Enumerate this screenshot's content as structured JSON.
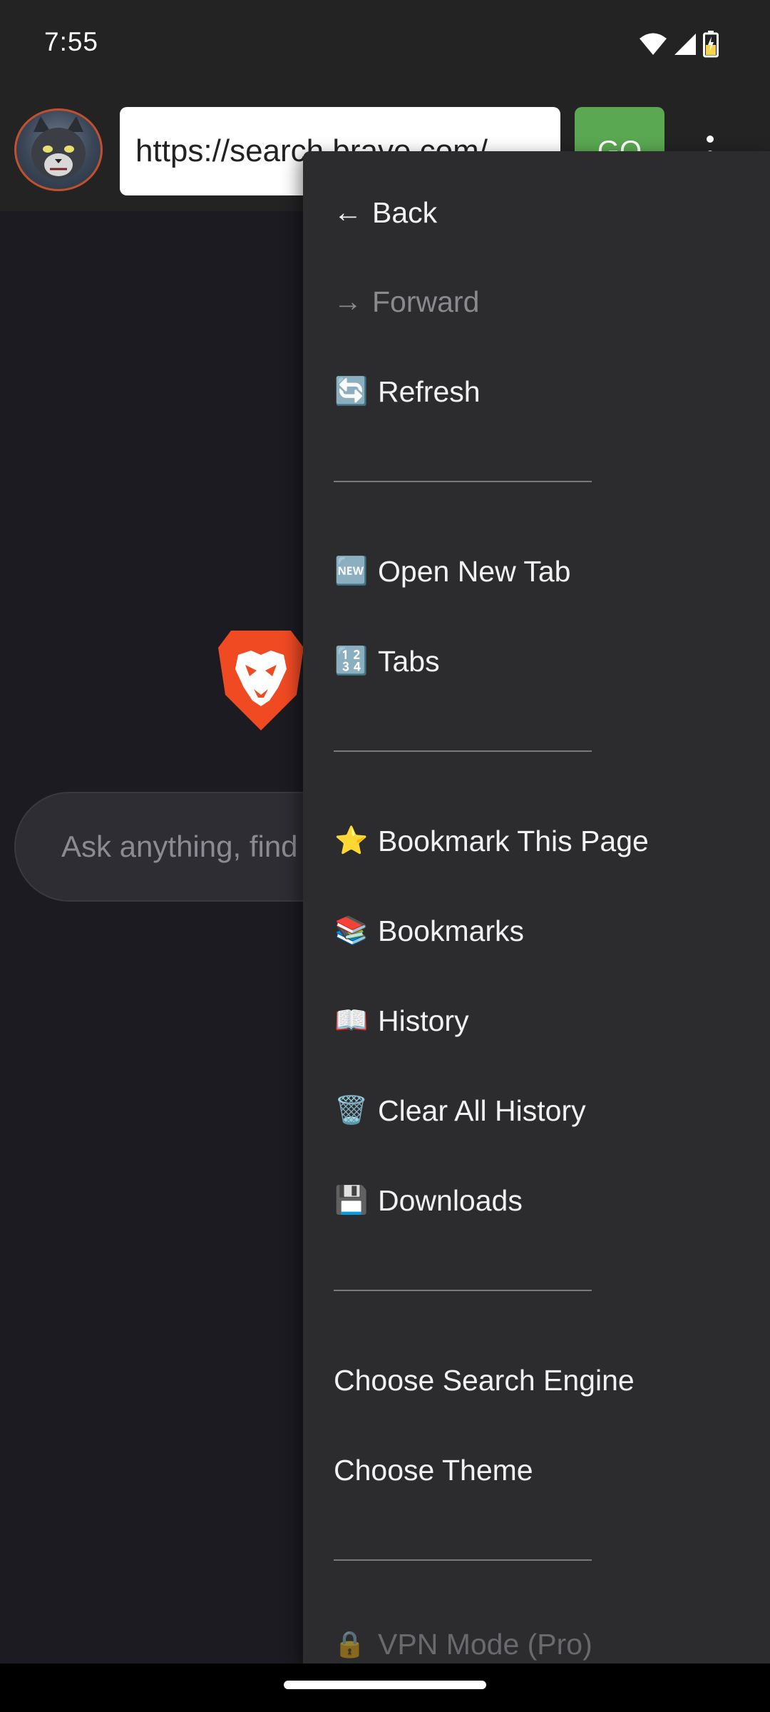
{
  "status_bar": {
    "time": "7:55",
    "icons": [
      "wifi-icon",
      "cellular-signal-icon",
      "battery-charging-icon"
    ]
  },
  "toolbar": {
    "url": "https://search.brave.com/",
    "go_label": "GO",
    "more_icon": "more-vert-icon"
  },
  "page": {
    "search_placeholder": "Ask anything, find anything"
  },
  "menu": {
    "back": {
      "arrow": "←",
      "label": "Back"
    },
    "forward": {
      "arrow": "→",
      "label": "Forward",
      "disabled": true
    },
    "refresh": {
      "emoji": "🔄",
      "label": "Refresh"
    },
    "separator": "________________",
    "open_new_tab": {
      "emoji": "🆕",
      "label": "Open New Tab"
    },
    "tabs": {
      "emoji": "🔢",
      "label": "Tabs"
    },
    "bookmark_this_page": {
      "emoji": "⭐",
      "label": "Bookmark This Page"
    },
    "bookmarks": {
      "emoji": "📚",
      "label": "Bookmarks"
    },
    "history": {
      "emoji": "📖",
      "label": "History"
    },
    "clear_all_history": {
      "emoji": "🗑️",
      "label": "Clear All History"
    },
    "downloads": {
      "emoji": "💾",
      "label": "Downloads"
    },
    "choose_search_engine": {
      "label": "Choose Search Engine"
    },
    "choose_theme": {
      "label": "Choose Theme"
    },
    "vpn_mode": {
      "emoji": "🔒",
      "label": "VPN Mode (Pro)"
    }
  },
  "colors": {
    "menu_background": "#2c2c2e",
    "go_button": "#5aa852",
    "brave_orange": "#f04a23",
    "disabled_text": "#8a8a8e"
  }
}
